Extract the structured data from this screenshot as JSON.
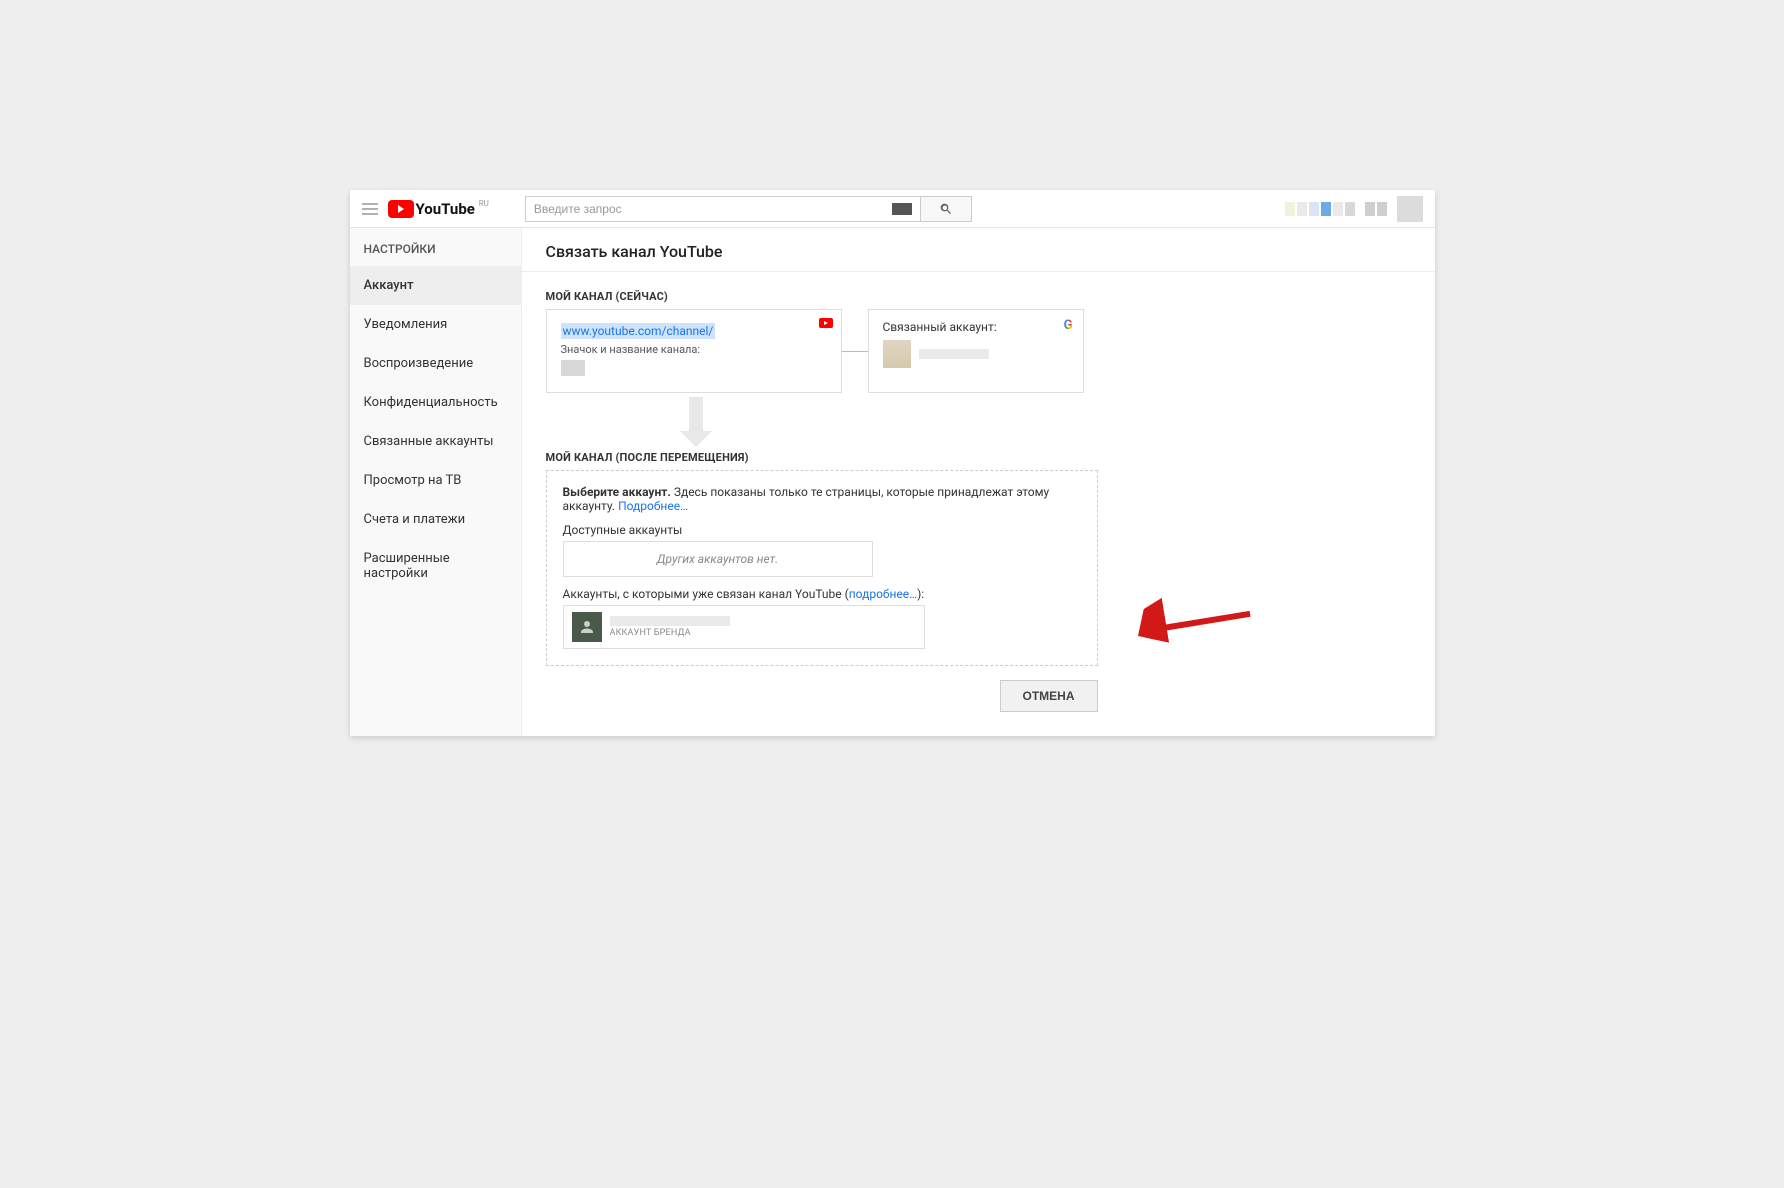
{
  "header": {
    "logo_text": "YouTube",
    "logo_sup": "RU",
    "search_placeholder": "Введите запрос"
  },
  "sidebar": {
    "title": "НАСТРОЙКИ",
    "items": [
      {
        "label": "Аккаунт",
        "active": true
      },
      {
        "label": "Уведомления"
      },
      {
        "label": "Воспроизведение"
      },
      {
        "label": "Конфиденциальность"
      },
      {
        "label": "Связанные аккаунты"
      },
      {
        "label": "Просмотр на ТВ"
      },
      {
        "label": "Счета и платежи"
      },
      {
        "label": "Расширенные настройки"
      }
    ]
  },
  "main": {
    "title": "Связать канал YouTube",
    "now_label": "МОЙ КАНАЛ (СЕЙЧАС)",
    "channel_url": "www.youtube.com/channel/",
    "channel_sub": "Значок и название канала:",
    "linked_account_label": "Связанный аккаунт:",
    "after_label": "МОЙ КАНАЛ (ПОСЛЕ ПЕРЕМЕЩЕНИЯ)",
    "choose_bold": "Выберите аккаунт.",
    "choose_rest": " Здесь показаны только те страницы, которые принадлежат этому аккаунту. ",
    "more_link": "Подробнее…",
    "available_label": "Доступные аккаунты",
    "no_accounts": "Других аккаунтов нет.",
    "linked_already_prefix": "Аккаунты, с которыми уже связан канал YouTube (",
    "linked_already_link": "подробнее…",
    "linked_already_suffix": "):",
    "brand_label": "АККАУНТ БРЕНДА",
    "cancel": "ОТМЕНА"
  }
}
